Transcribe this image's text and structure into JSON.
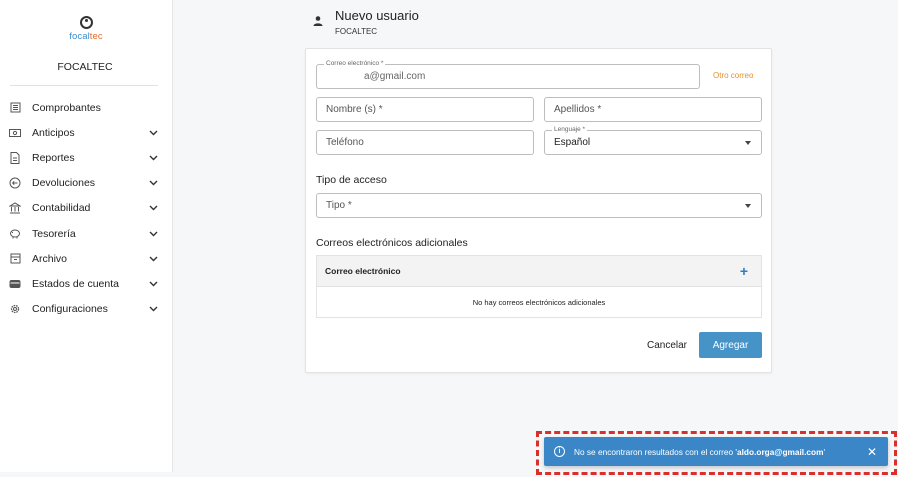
{
  "sidebar": {
    "logo_text_a": "focal",
    "logo_text_b": "tec",
    "company": "FOCALTEC",
    "items": [
      {
        "label": "Comprobantes",
        "icon": "receipt-icon",
        "expandable": false
      },
      {
        "label": "Anticipos",
        "icon": "cash-icon",
        "expandable": true
      },
      {
        "label": "Reportes",
        "icon": "document-icon",
        "expandable": true
      },
      {
        "label": "Devoluciones",
        "icon": "return-icon",
        "expandable": true
      },
      {
        "label": "Contabilidad",
        "icon": "bank-icon",
        "expandable": true
      },
      {
        "label": "Tesorería",
        "icon": "piggy-bank-icon",
        "expandable": true
      },
      {
        "label": "Archivo",
        "icon": "archive-icon",
        "expandable": true
      },
      {
        "label": "Estados de cuenta",
        "icon": "wallet-icon",
        "expandable": true
      },
      {
        "label": "Configuraciones",
        "icon": "gear-icon",
        "expandable": true
      }
    ]
  },
  "header": {
    "title": "Nuevo usuario",
    "subtitle": "FOCALTEC"
  },
  "form": {
    "email_label": "Correo electrónico *",
    "email_value": "a@gmail.com",
    "otro_correo": "Otro correo",
    "nombre_placeholder": "Nombre (s) *",
    "apellidos_placeholder": "Apellidos *",
    "telefono_placeholder": "Teléfono",
    "lenguaje_label": "Lenguaje *",
    "lenguaje_value": "Español",
    "tipo_acceso_title": "Tipo de acceso",
    "tipo_placeholder": "Tipo *",
    "correos_title": "Correos electrónicos adicionales",
    "table_header": "Correo electrónico",
    "table_empty": "No hay correos electrónicos adicionales",
    "cancel_label": "Cancelar",
    "add_label": "Agregar"
  },
  "snackbar": {
    "text_prefix": "No se encontraron resultados con el correo '",
    "email": "aldo.orga@gmail.com",
    "text_suffix": "'"
  },
  "colors": {
    "primary": "#4693c8",
    "snackbar": "#3a86c6",
    "accent_link": "#e8912a",
    "highlight_outline": "#d9302c"
  }
}
